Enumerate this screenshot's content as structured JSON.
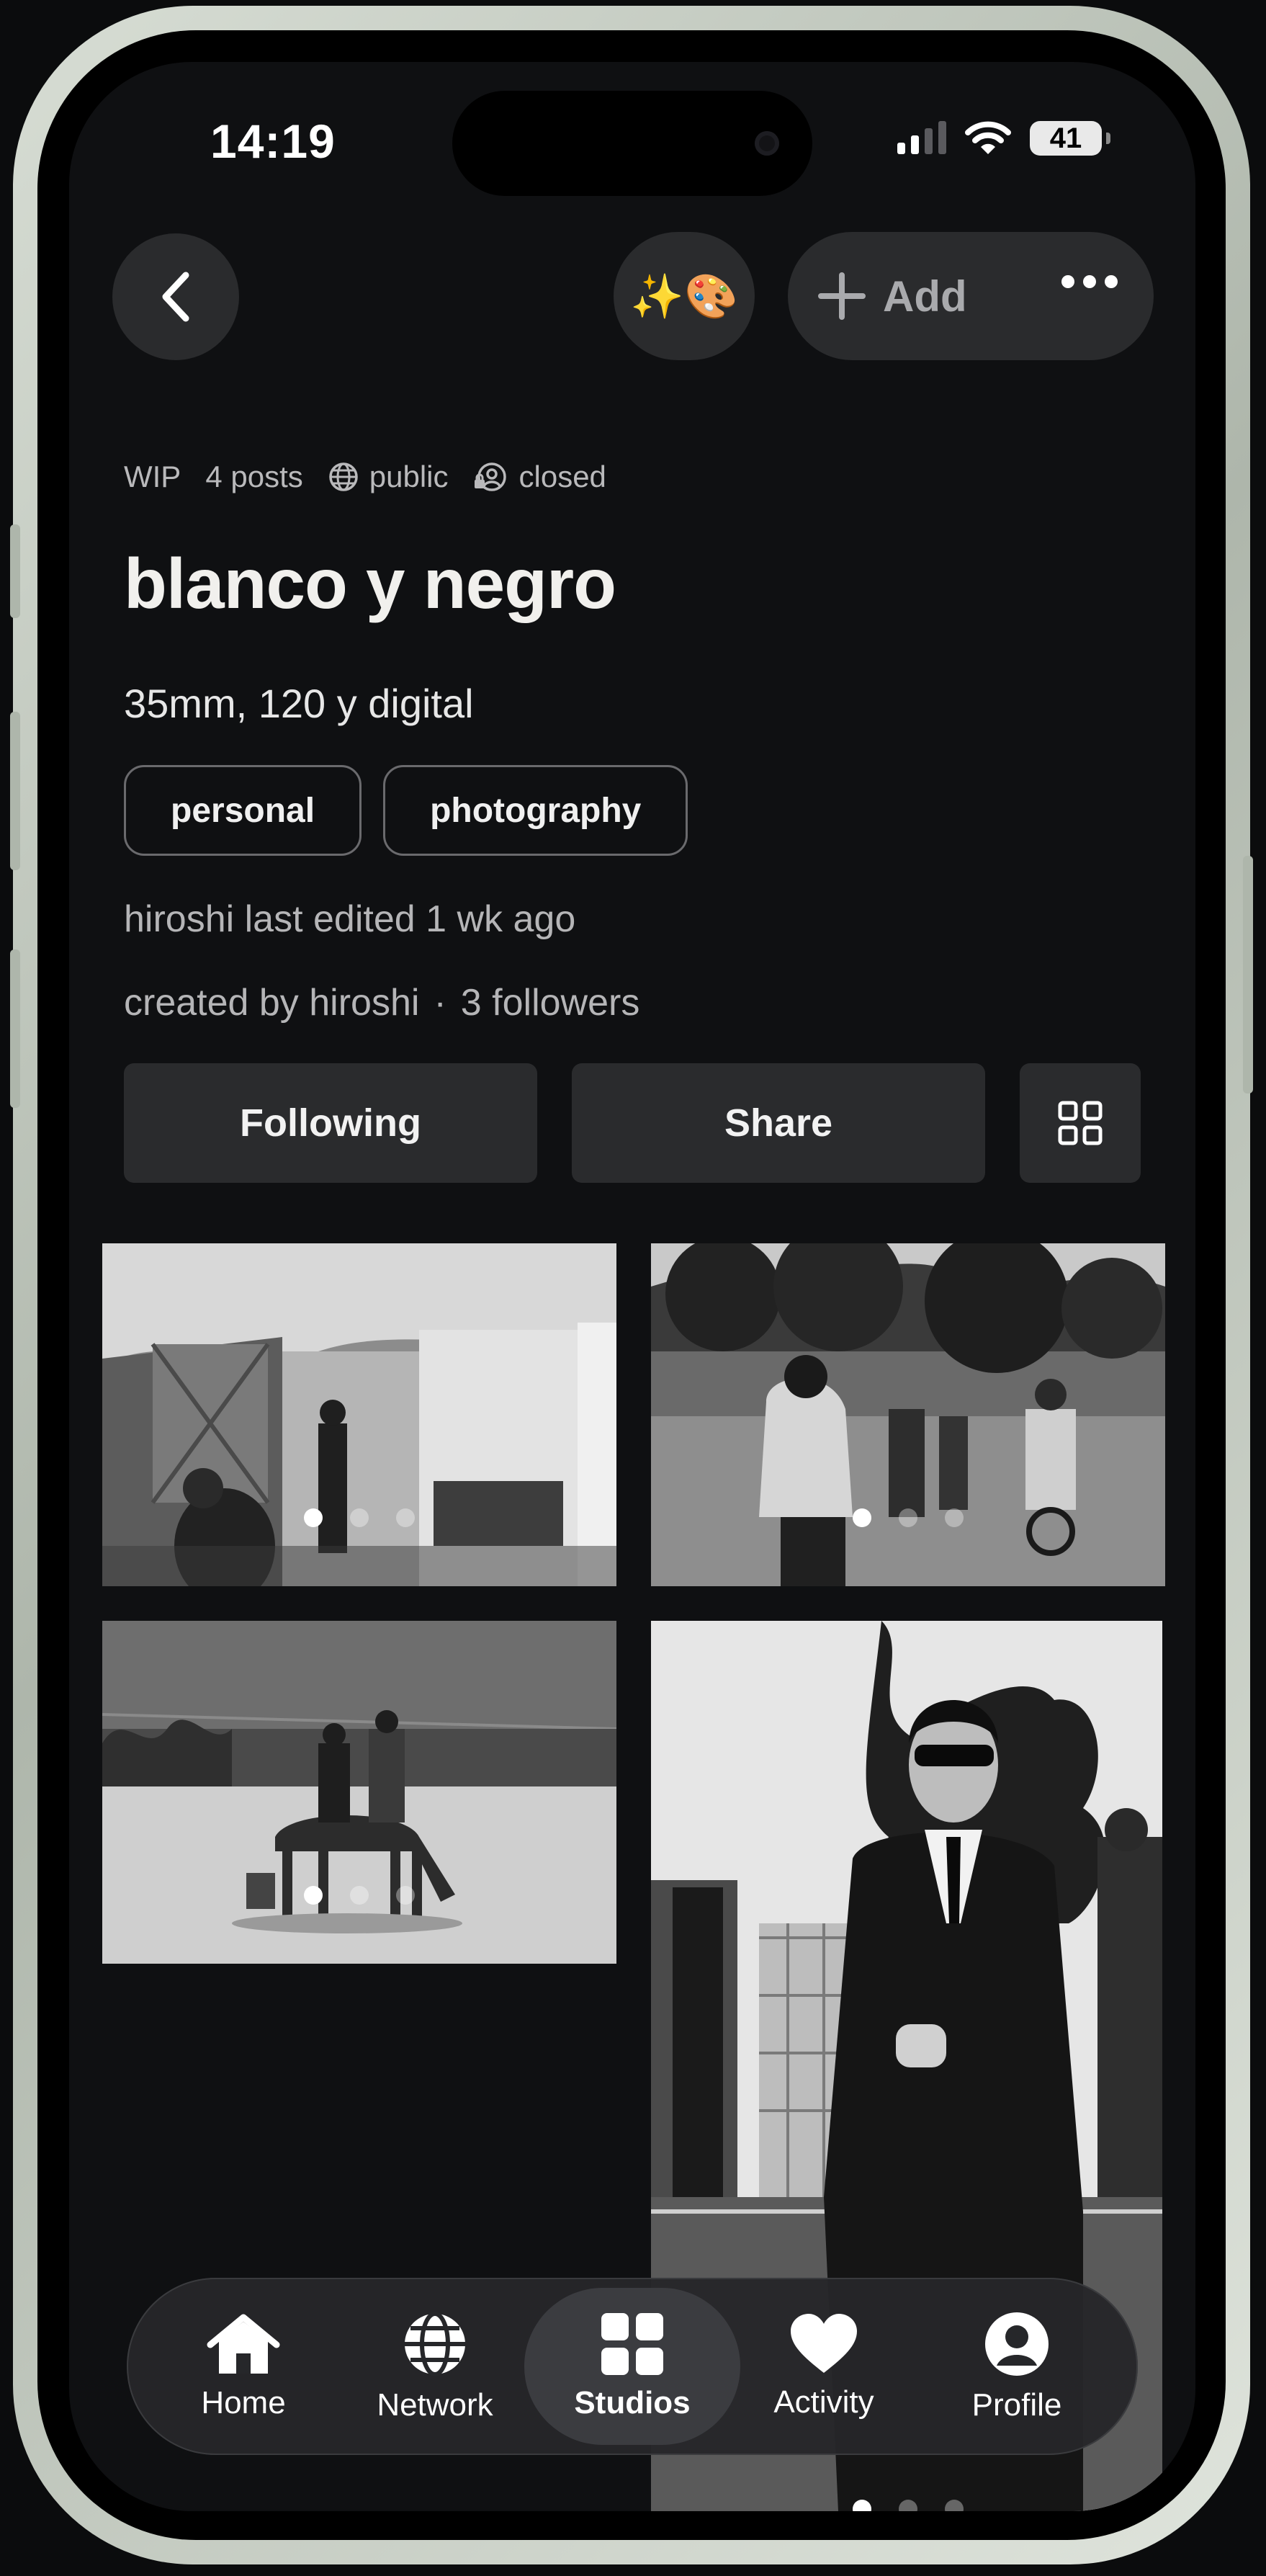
{
  "status_bar": {
    "time": "14:19",
    "battery": "41"
  },
  "header": {
    "emoji_button": "✨🎨",
    "add_label": "Add"
  },
  "meta": {
    "status": "WIP",
    "posts": "4 posts",
    "visibility": "public",
    "access": "closed"
  },
  "collection": {
    "title": "blanco y negro",
    "description": "35mm, 120 y digital",
    "tags": [
      "personal",
      "photography"
    ],
    "last_edited": "hiroshi last edited 1 wk ago",
    "created_by": "created by hiroshi",
    "separator": "·",
    "followers": "3 followers"
  },
  "actions": {
    "following_label": "Following",
    "share_label": "Share"
  },
  "photos": [
    {
      "subject": "market stalls",
      "carousel_count": 3,
      "carousel_index": 1
    },
    {
      "subject": "cyclists in park",
      "carousel_count": 3,
      "carousel_index": 1
    },
    {
      "subject": "riders on beach with horse",
      "carousel_count": 3,
      "carousel_index": 1
    },
    {
      "subject": "man in suit and sunglasses",
      "carousel_count": 3,
      "carousel_index": 1
    }
  ],
  "tabbar": {
    "items": [
      {
        "label": "Home",
        "icon": "house-icon"
      },
      {
        "label": "Network",
        "icon": "globe-icon"
      },
      {
        "label": "Studios",
        "icon": "grid-icon",
        "active": true
      },
      {
        "label": "Activity",
        "icon": "heart-icon"
      },
      {
        "label": "Profile",
        "icon": "person-circle-icon"
      }
    ]
  }
}
